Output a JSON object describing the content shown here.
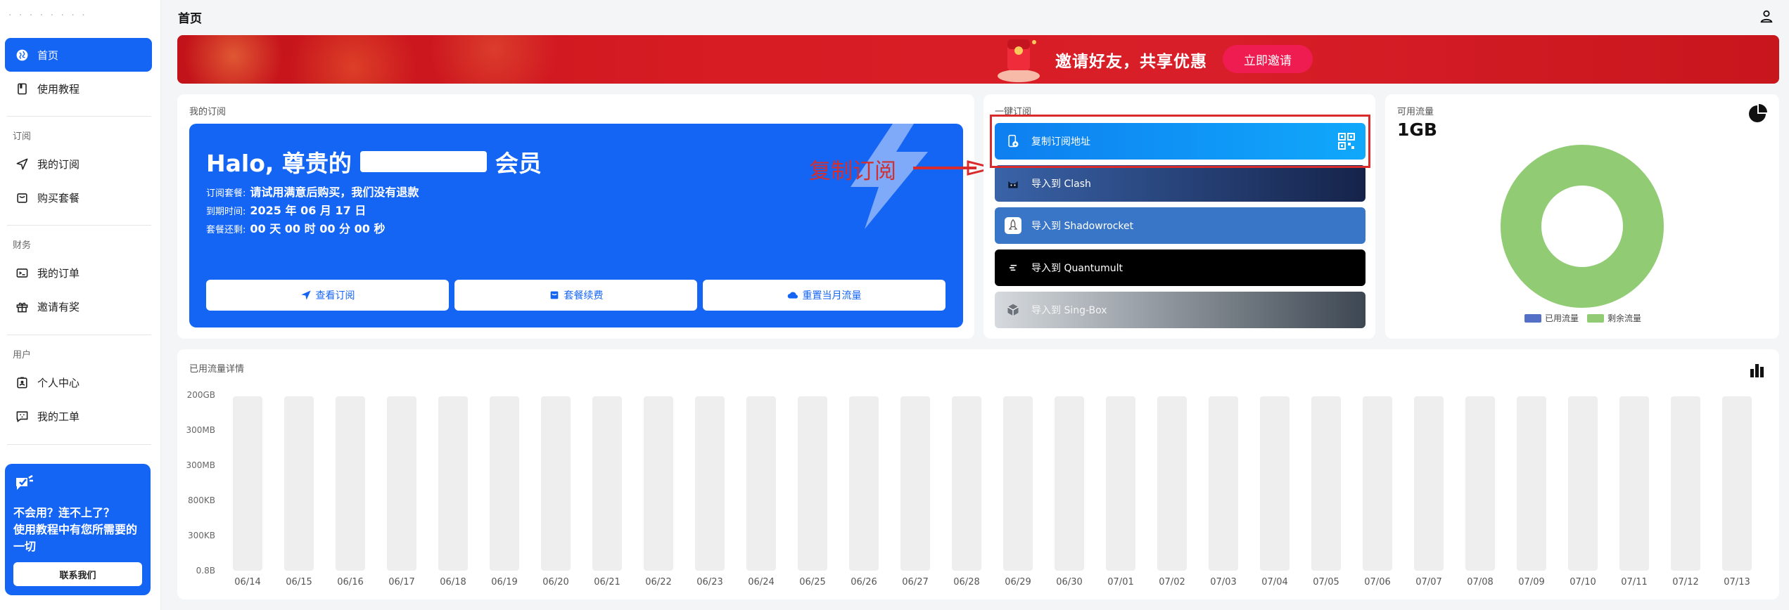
{
  "colors": {
    "primary": "#1565f5",
    "banner": "#d81e28",
    "banner_button": "#ef1c52",
    "annotation": "#d92b2b",
    "used": "#5470c6",
    "remaining": "#91cc75",
    "bar_track": "#eeeeee"
  },
  "sidebar": {
    "logo_text": "· · · ·  · · · ·",
    "items": [
      {
        "label": "首页",
        "icon": "globe-icon",
        "active": true
      },
      {
        "label": "使用教程",
        "icon": "book-icon"
      },
      {
        "label": "我的订阅",
        "icon": "send-icon"
      },
      {
        "label": "购买套餐",
        "icon": "bag-icon"
      },
      {
        "label": "我的订单",
        "icon": "terminal-icon"
      },
      {
        "label": "邀请有奖",
        "icon": "gift-icon"
      },
      {
        "label": "个人中心",
        "icon": "id-card-icon"
      },
      {
        "label": "我的工单",
        "icon": "chat-icon"
      }
    ],
    "sections": [
      "订阅",
      "财务",
      "用户"
    ],
    "help": {
      "line1": "不会用？连不上了？",
      "line2": "使用教程中有您所需要的一切",
      "button": "联系我们"
    }
  },
  "header": {
    "title": "首页"
  },
  "banner": {
    "text": "邀请好友，共享优惠",
    "button": "立即邀请"
  },
  "subscription": {
    "label": "我的订阅",
    "greeting_prefix": "Halo, 尊贵的",
    "greeting_suffix": "会员",
    "plan_label": "订阅套餐:",
    "plan_value": "请试用满意后购买，我们没有退款",
    "expire_label": "到期时间:",
    "expire_value": "2025 年 06 月 17 日",
    "reset_label": "套餐还剩:",
    "reset_value": "00 天 00 时 00 分 00 秒",
    "buttons": [
      "查看订阅",
      "套餐续费",
      "重置当月流量"
    ]
  },
  "one_click": {
    "label": "一键订阅",
    "annotation": "复制订阅",
    "items": [
      {
        "label": "复制订阅地址",
        "icon": "phone-link-icon",
        "bg": "#0e8ef5"
      },
      {
        "label": "导入到 Clash",
        "icon": "clash-cat-icon",
        "bg": "#26437a"
      },
      {
        "label": "导入到 Shadowrocket",
        "icon": "rocket-icon",
        "bg": "#3a76c8"
      },
      {
        "label": "导入到 Quantumult",
        "icon": "quantumult-icon",
        "bg": "#000000"
      },
      {
        "label": "导入到 Sing-Box",
        "icon": "box-icon",
        "bg": "#5b6773"
      }
    ]
  },
  "traffic": {
    "label": "可用流量",
    "value": "1GB",
    "legend": [
      "已用流量",
      "剩余流量"
    ],
    "used_fraction": 0
  },
  "chart_data": {
    "type": "bar",
    "title": "已用流量详情",
    "categories": [
      "06/14",
      "06/15",
      "06/16",
      "06/17",
      "06/18",
      "06/19",
      "06/20",
      "06/21",
      "06/22",
      "06/23",
      "06/24",
      "06/25",
      "06/26",
      "06/27",
      "06/28",
      "06/29",
      "06/30",
      "07/01",
      "07/02",
      "07/03",
      "07/04",
      "07/05",
      "07/06",
      "07/07",
      "07/08",
      "07/09",
      "07/10",
      "07/11",
      "07/12",
      "07/13"
    ],
    "values": [
      0,
      0,
      0,
      0,
      0,
      0,
      0,
      0,
      0,
      0,
      0,
      0,
      0,
      0,
      0,
      0,
      0,
      0,
      0,
      0,
      0,
      0,
      0,
      0,
      0,
      0,
      0,
      0,
      0,
      0
    ],
    "y_ticks": [
      "200GB",
      "300MB",
      "300MB",
      "800KB",
      "300KB",
      "0.8B"
    ],
    "grid": false
  }
}
